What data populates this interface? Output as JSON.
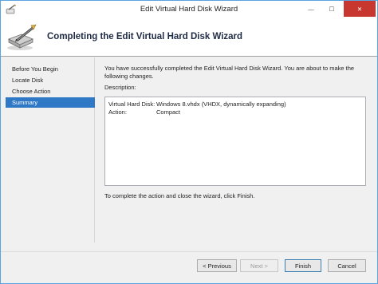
{
  "window": {
    "title": "Edit Virtual Hard Disk Wizard",
    "min_glyph": "—",
    "max_glyph": "☐",
    "close_glyph": "✕"
  },
  "header": {
    "title": "Completing the Edit Virtual Hard Disk Wizard",
    "icon": "disk-wizard-icon"
  },
  "nav": {
    "items": [
      {
        "label": "Before You Begin",
        "active": false
      },
      {
        "label": "Locate Disk",
        "active": false
      },
      {
        "label": "Choose Action",
        "active": false
      },
      {
        "label": "Summary",
        "active": true
      }
    ]
  },
  "content": {
    "intro": "You have successfully completed the Edit Virtual Hard Disk Wizard. You are about to make the following changes.",
    "description_label": "Description:",
    "summary": [
      {
        "key": "Virtual Hard Disk:",
        "value": "Windows 8.vhdx (VHDX, dynamically expanding)"
      },
      {
        "key": "Action:",
        "value": "Compact"
      }
    ],
    "finish_note": "To complete the action and close the wizard, click Finish."
  },
  "buttons": {
    "previous": "< Previous",
    "next": "Next >",
    "finish": "Finish",
    "cancel": "Cancel"
  },
  "colors": {
    "accent": "#2f78c6",
    "close": "#c7372f",
    "border": "#5ba3e0"
  }
}
